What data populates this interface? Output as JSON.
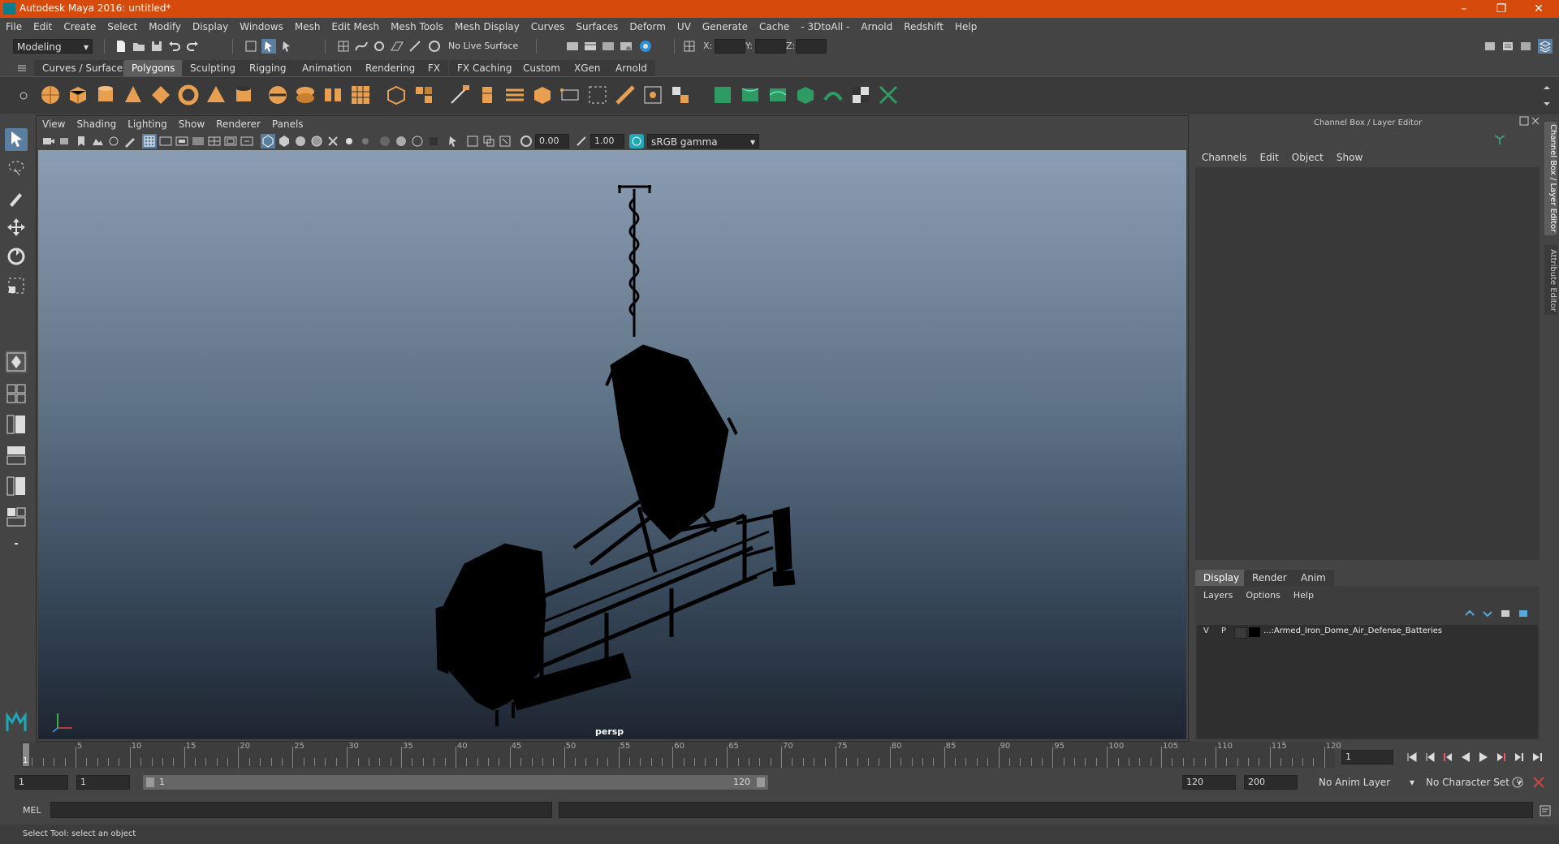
{
  "window": {
    "title": "Autodesk Maya 2016: untitled*",
    "minimize": "–",
    "restore": "❐",
    "close": "✕"
  },
  "menu": [
    "File",
    "Edit",
    "Create",
    "Select",
    "Modify",
    "Display",
    "Windows",
    "Mesh",
    "Edit Mesh",
    "Mesh Tools",
    "Mesh Display",
    "Curves",
    "Surfaces",
    "Deform",
    "UV",
    "Generate",
    "Cache",
    "- 3DtoAll -",
    "Arnold",
    "Redshift",
    "Help"
  ],
  "status": {
    "mode": "Modeling",
    "live_surface": "No Live Surface",
    "x_label": "X:",
    "y_label": "Y:",
    "z_label": "Z:"
  },
  "shelf_tabs": [
    "Curves / Surfaces",
    "Polygons",
    "Sculpting",
    "Rigging",
    "Animation",
    "Rendering",
    "FX",
    "FX Caching",
    "Custom",
    "XGen",
    "Arnold"
  ],
  "shelf_active": "Polygons",
  "viewport": {
    "menu": [
      "View",
      "Shading",
      "Lighting",
      "Show",
      "Renderer",
      "Panels"
    ],
    "exposure": "0.00",
    "gamma": "1.00",
    "color_space": "sRGB gamma",
    "camera": "persp"
  },
  "channel_box": {
    "title": "Channel Box / Layer Editor",
    "menu": [
      "Channels",
      "Edit",
      "Object",
      "Show"
    ]
  },
  "layer_editor": {
    "tabs": [
      "Display",
      "Render",
      "Anim"
    ],
    "active_tab": "Display",
    "menu": [
      "Layers",
      "Options",
      "Help"
    ],
    "layers": [
      {
        "v": "V",
        "p": "P",
        "name": "...:Armed_Iron_Dome_Air_Defense_Batteries"
      }
    ]
  },
  "side_tabs": [
    "Channel Box / Layer Editor",
    "Attribute Editor"
  ],
  "timeline": {
    "ticks": [
      "5",
      "10",
      "15",
      "20",
      "25",
      "30",
      "35",
      "40",
      "45",
      "50",
      "55",
      "60",
      "65",
      "70",
      "75",
      "80",
      "85",
      "90",
      "95",
      "100",
      "105",
      "110",
      "115",
      "120"
    ],
    "start_label": "1",
    "current_frame": "1"
  },
  "range": {
    "start": "1",
    "playback_start": "1",
    "slider_start": "1",
    "slider_end": "120",
    "playback_end": "120",
    "end": "200",
    "anim_layer": "No Anim Layer",
    "character_set": "No Character Set"
  },
  "command_line": {
    "label": "MEL"
  },
  "help_line": "Select Tool: select an object",
  "colors": {
    "titlebar": "#d64a0c",
    "accent": "#5d5d5d",
    "shelf_green": "#2f9b64",
    "shelf_orange": "#e8a050"
  }
}
